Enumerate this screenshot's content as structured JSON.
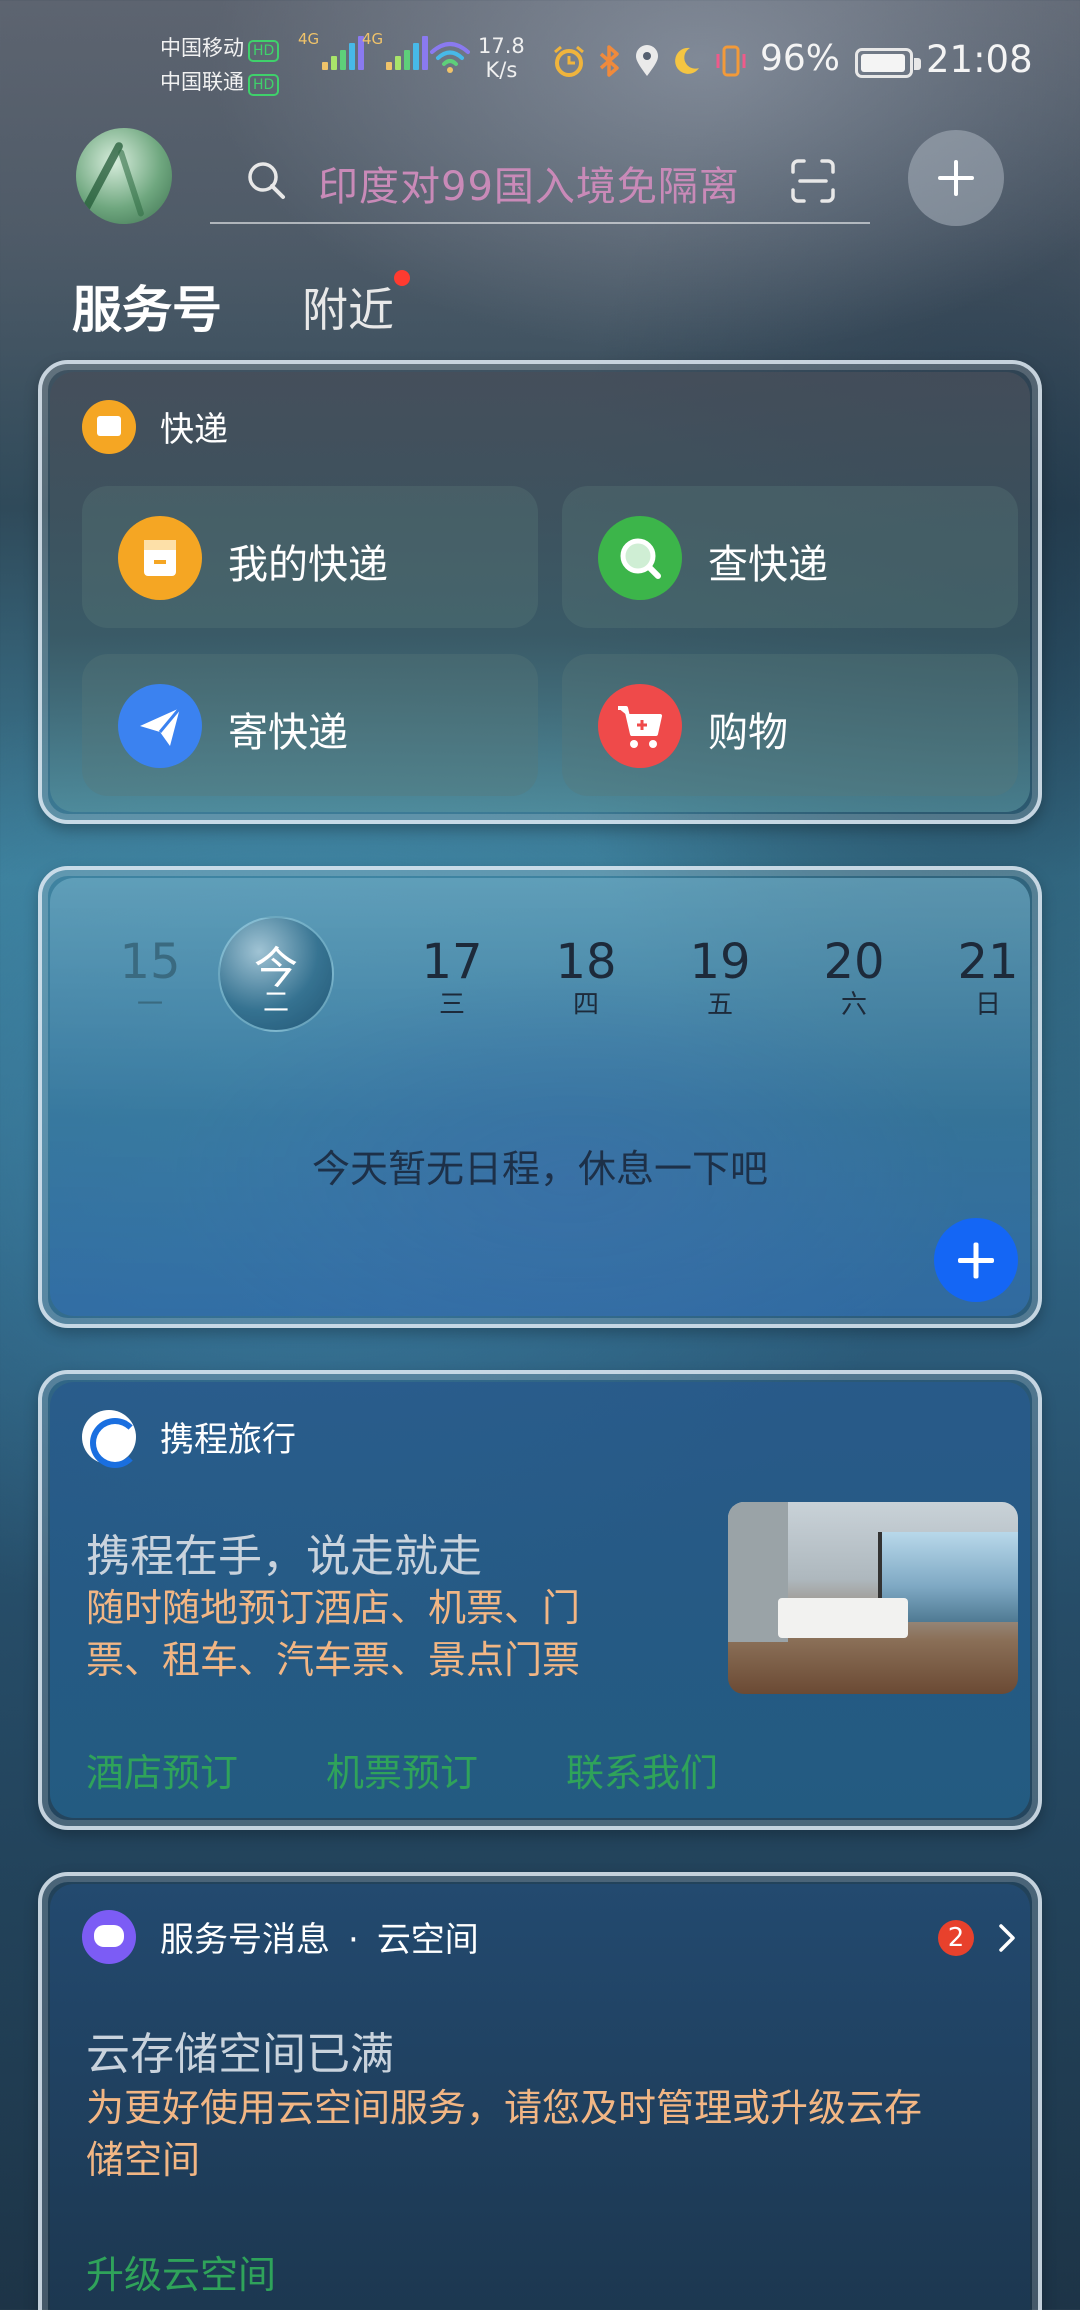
{
  "status_bar": {
    "carrier_1": "中国移动",
    "carrier_2": "中国联通",
    "hd_label": "HD",
    "network_1": "4G",
    "network_2": "4G",
    "speed_value": "17.8",
    "speed_unit": "K/s",
    "battery_percent": "96%",
    "battery_level": 0.96,
    "time": "21:08",
    "icons": [
      "alarm-icon",
      "bluetooth-icon",
      "location-icon",
      "moon-icon",
      "vibrate-icon"
    ]
  },
  "header": {
    "search_placeholder": "印度对99国入境免隔离"
  },
  "tabs": {
    "active": "服务号",
    "other": "附近"
  },
  "express_card": {
    "title": "快递",
    "tiles": [
      {
        "label": "我的快递",
        "icon": "package-icon",
        "color": "#f5a623"
      },
      {
        "label": "查快递",
        "icon": "search-icon",
        "color": "#3cb54a"
      },
      {
        "label": "寄快递",
        "icon": "send-icon",
        "color": "#3b82f0"
      },
      {
        "label": "购物",
        "icon": "cart-icon",
        "color": "#ef4a4a"
      }
    ]
  },
  "calendar_card": {
    "days": [
      {
        "num": "15",
        "weekday": "一"
      },
      {
        "num": "今",
        "weekday": "二"
      },
      {
        "num": "17",
        "weekday": "三"
      },
      {
        "num": "18",
        "weekday": "四"
      },
      {
        "num": "19",
        "weekday": "五"
      },
      {
        "num": "20",
        "weekday": "六"
      },
      {
        "num": "21",
        "weekday": "日"
      }
    ],
    "empty_text": "今天暂无日程，休息一下吧"
  },
  "ctrip_card": {
    "title": "携程旅行",
    "headline": "携程在手，说走就走",
    "description_line_1": "随时随地预订酒店、机票、门",
    "description_line_2": "票、租车、汽车票、景点门票",
    "actions": [
      "酒店预订",
      "机票预订",
      "联系我们"
    ]
  },
  "message_card": {
    "title": "服务号消息",
    "source": "云空间",
    "separator": "·",
    "badge_count": "2",
    "headline": "云存储空间已满",
    "body_line_1": "为更好使用云空间服务，请您及时管理或升级云存",
    "body_line_2": "储空间",
    "action": "升级云空间"
  }
}
